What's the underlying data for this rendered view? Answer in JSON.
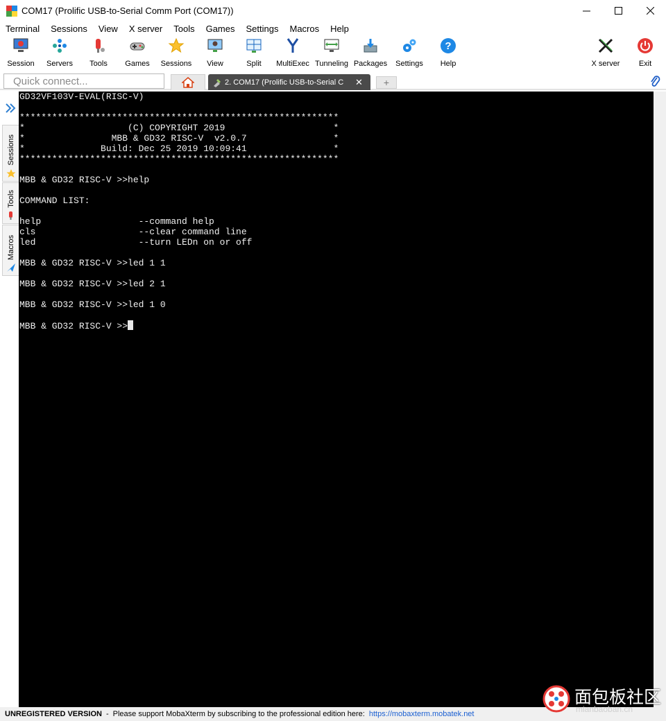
{
  "window": {
    "title": "COM17  (Prolific USB-to-Serial Comm Port (COM17))",
    "minimize": "—",
    "maximize": "☐",
    "close": "✕"
  },
  "menu": [
    "Terminal",
    "Sessions",
    "View",
    "X server",
    "Tools",
    "Games",
    "Settings",
    "Macros",
    "Help"
  ],
  "toolbar": {
    "session": "Session",
    "servers": "Servers",
    "tools": "Tools",
    "games": "Games",
    "sessions": "Sessions",
    "view": "View",
    "split": "Split",
    "multiexec": "MultiExec",
    "tunneling": "Tunneling",
    "packages": "Packages",
    "settings": "Settings",
    "help": "Help",
    "xserver": "X server",
    "exit": "Exit"
  },
  "quick_connect": {
    "placeholder": "Quick connect..."
  },
  "tabs": {
    "active_title": "2. COM17 (Prolific USB-to-Serial C",
    "close": "✕",
    "new_tab": "+"
  },
  "side_tabs": {
    "sessions": "Sessions",
    "tools": "Tools",
    "macros": "Macros"
  },
  "terminal": {
    "lines": [
      "GD32VF103V-EVAL(RISC-V)",
      "",
      "***********************************************************",
      "*                   (C) COPYRIGHT 2019                    *",
      "*                MBB & GD32 RISC-V  v2.0.7                *",
      "*              Build: Dec 25 2019 10:09:41                *",
      "***********************************************************",
      "",
      "MBB & GD32 RISC-V >>help",
      "",
      "COMMAND LIST:",
      "",
      "help                  --command help",
      "cls                   --clear command line",
      "led                   --turn LEDn on or off",
      "",
      "MBB & GD32 RISC-V >>led 1 1",
      "",
      "MBB & GD32 RISC-V >>led 2 1",
      "",
      "MBB & GD32 RISC-V >>led 1 0",
      "",
      "MBB & GD32 RISC-V >>"
    ]
  },
  "status": {
    "unregistered": "UNREGISTERED VERSION",
    "sep": "-",
    "message": "Please support MobaXterm by subscribing to the professional edition here:",
    "link": "https://mobaxterm.mobatek.net"
  },
  "watermark": {
    "text": "面包板社区",
    "sub": "mianbaoban.cn"
  }
}
